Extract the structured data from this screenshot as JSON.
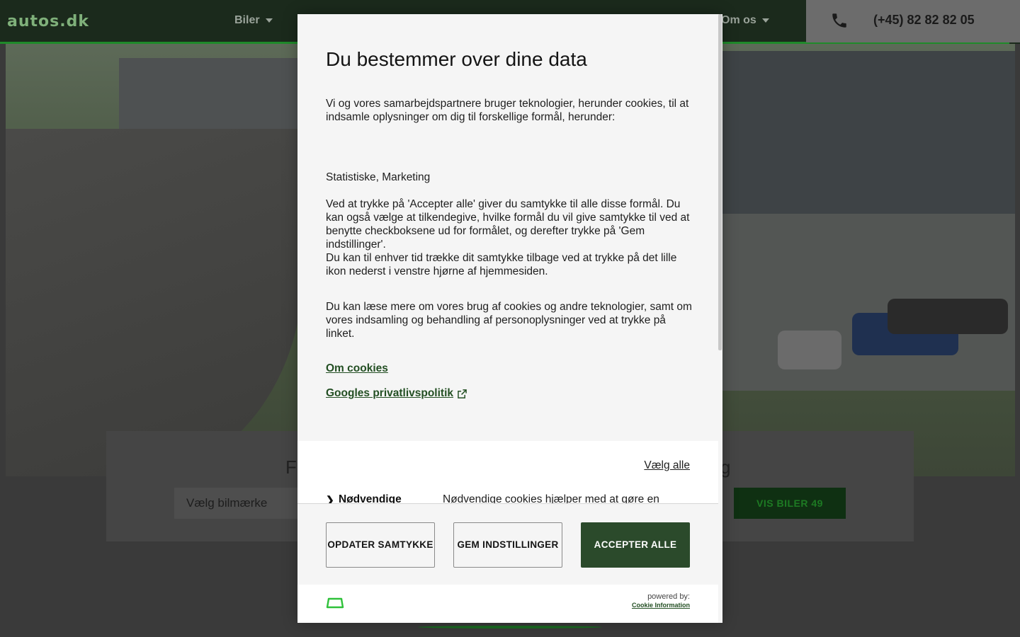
{
  "header": {
    "logo": "autos.dk",
    "nav": [
      {
        "label": "Biler"
      },
      {
        "label": "Om os"
      }
    ],
    "phone": "(+45) 82 82 82 05"
  },
  "search": {
    "title_left": "F",
    "title_right": "g",
    "brand_placeholder": "Vælg bilmærke",
    "show_button": "VIS BILER 49"
  },
  "modal": {
    "title": "Du bestemmer over dine data",
    "paragraphs": [
      "Vi og vores samarbejdspartnere bruger teknologier, herunder cookies, til at indsamle oplysninger om dig til forskellige formål, herunder:",
      "Statistiske, Marketing",
      "Ved at trykke på 'Accepter alle' giver du samtykke til alle disse formål. Du kan også vælge at tilkendegive, hvilke formål du vil give samtykke til ved at benytte checkboksene ud for formålet, og derefter trykke på 'Gem indstillinger'.",
      "Du kan til enhver tid trække dit samtykke tilbage ved at trykke på det lille ikon nederst i venstre hjørne af hjemmesiden.",
      "Du kan læse mere om vores brug af cookies og andre teknologier, samt om vores indsamling og behandling af personoplysninger ved at trykke på linket."
    ],
    "links": [
      {
        "label": "Om cookies"
      },
      {
        "label": "Googles privatlivspolitik"
      }
    ],
    "select_all": "Vælg alle",
    "purpose": {
      "name": "Nødvendige",
      "description": "Nødvendige cookies hjælper med at gøre en"
    },
    "buttons": {
      "update": "OPDATER SAMTYKKE",
      "save": "GEM INDSTILLINGER",
      "accept": "ACCEPTER ALLE"
    },
    "powered_by": "powered by:",
    "provider": "Cookie Information"
  },
  "colors": {
    "brand_green": "#2b4a2b",
    "link_green": "#234f23",
    "header_bg": "#1b2a1c"
  }
}
